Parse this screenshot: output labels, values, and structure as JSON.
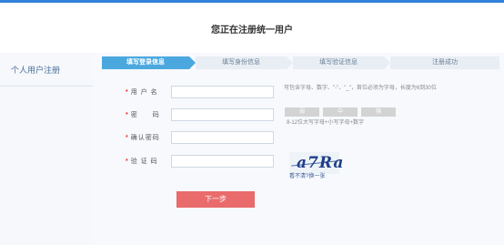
{
  "header": {
    "title": "您正在注册统一用户"
  },
  "sidebar": {
    "title": "个人用户注册"
  },
  "steps": [
    {
      "label": "填写登录信息",
      "active": true
    },
    {
      "label": "填写身份信息",
      "active": false
    },
    {
      "label": "填写验证信息",
      "active": false
    },
    {
      "label": "注册成功",
      "active": false
    }
  ],
  "form": {
    "username": {
      "label": "用 户 名",
      "value": "",
      "hint": "可包含字母、数字、\"-\"、\"_\"，首位必须为字母，长度为6到30位"
    },
    "password": {
      "label": "密　　码",
      "value": "",
      "hint": "8-12位大写字母+小写字母+数字"
    },
    "confirm": {
      "label": "确认密码",
      "value": ""
    },
    "captcha": {
      "label": "验 证 码",
      "value": "",
      "image_text": "a7Ra",
      "refresh_text": "看不清?换一张"
    }
  },
  "strength": [
    "弱",
    "中",
    "强"
  ],
  "actions": {
    "next": "下一步"
  },
  "colors": {
    "accent": "#4aa8df",
    "button": "#e96b6b",
    "required": "#ee3333"
  }
}
